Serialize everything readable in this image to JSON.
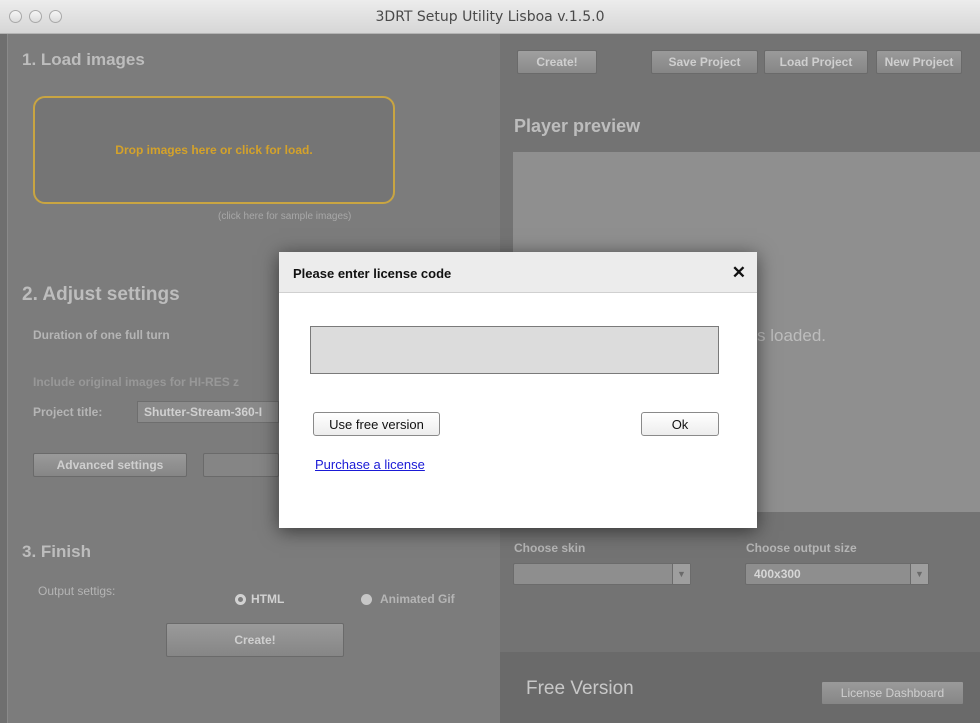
{
  "window": {
    "title": "3DRT Setup Utility Lisboa v.1.5.0"
  },
  "load_section": {
    "heading": "1. Load images",
    "dropzone_text": "Drop images here or click for load.",
    "sample_link": "(click here for sample images)"
  },
  "settings_section": {
    "heading": "2. Adjust settings",
    "duration_label": "Duration of one full turn",
    "hires_label": "Include original images for HI-RES z",
    "project_title_label": "Project title:",
    "project_title_value": "Shutter-Stream-360-I",
    "advanced_button": "Advanced settings"
  },
  "finish_section": {
    "heading": "3. Finish",
    "output_label": "Output settigs:",
    "radio_html": "HTML",
    "radio_gif": "Animated Gif",
    "create_button": "Create!"
  },
  "toolbar": {
    "create": "Create!",
    "save_project": "Save Project",
    "load_project": "Load Project",
    "new_project": "New Project"
  },
  "preview": {
    "heading": "Player preview",
    "status_fragment": "s loaded."
  },
  "skin": {
    "label": "Choose skin",
    "value": ""
  },
  "output_size": {
    "label": "Choose output size",
    "value": "400x300"
  },
  "footer": {
    "version_text": "Free Version",
    "license_dashboard": "License Dashboard"
  },
  "dialog": {
    "title": "Please enter license code",
    "close_glyph": "✕",
    "license_value": "",
    "free_button": "Use free version",
    "ok_button": "Ok",
    "purchase_link": "Purchase a license"
  },
  "colors": {
    "accent_dropzone": "#c9a542",
    "link": "#1a1ad6"
  }
}
